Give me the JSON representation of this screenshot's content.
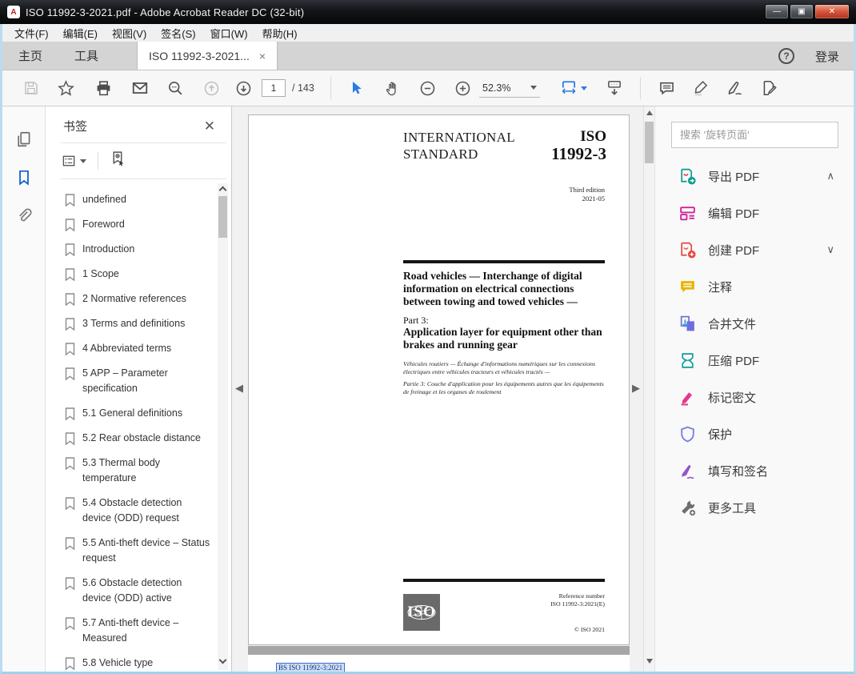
{
  "colors": {
    "accent_blue": "#2a7ce0",
    "bookmark_blue": "#1b66c9",
    "close_red": "#c0392b",
    "export_teal": "#0a9c8f",
    "edit_magenta": "#d6219c",
    "create_red": "#e5483f",
    "comment_yellow": "#e7b500",
    "combine_indigo": "#6e6ee0",
    "compress_teal": "#0a9c9c",
    "redact_pink": "#e5398d",
    "protect_periwinkle": "#7b7fe0",
    "sign_purple": "#9256c8",
    "more_gray": "#6e6e6e",
    "selection_blue": "#3b6bd6"
  },
  "window": {
    "title": "ISO 11992-3-2021.pdf - Adobe Acrobat Reader DC (32-bit)",
    "minimize_glyph": "—",
    "maximize_glyph": "▣",
    "close_glyph": "✕"
  },
  "menu": {
    "items": [
      "文件(F)",
      "编辑(E)",
      "视图(V)",
      "签名(S)",
      "窗口(W)",
      "帮助(H)"
    ]
  },
  "tabs": {
    "home": "主页",
    "tools": "工具",
    "document": "ISO 11992-3-2021...",
    "doc_close_glyph": "×",
    "help_glyph": "?",
    "sign_in": "登录"
  },
  "toolbar": {
    "page_current": "1",
    "page_total": "/ 143",
    "zoom_value": "52.3%"
  },
  "bookmarks": {
    "title": "书签",
    "items": [
      "undefined",
      "Foreword",
      "Introduction",
      "1 Scope",
      "2 Normative references",
      "3 Terms and definitions",
      "4 Abbreviated terms",
      "5 APP – Parameter specification",
      "5.1 General definitions",
      "5.2 Rear obstacle distance",
      "5.3 Thermal body temperature",
      "5.4 Obstacle detection device (ODD) request",
      "5.5 Anti-theft device – Status request",
      "5.6 Obstacle detection device (ODD) active",
      "5.7 Anti-theft device – Measured",
      "5.8 Vehicle type"
    ]
  },
  "document": {
    "header_left_1": "INTERNATIONAL",
    "header_left_2": "STANDARD",
    "std_number_1": "ISO",
    "std_number_2": "11992-3",
    "edition_1": "Third edition",
    "edition_2": "2021-05",
    "title_en": "Road vehicles — Interchange of digital information on electrical connections between towing and towed vehicles —",
    "part_label": "Part 3:",
    "subtitle_en": "Application layer for equipment other than brakes and running gear",
    "title_fr": "Véhicules routiers — Échange d'informations numériques sur les connexions électriques entre véhicules tracteurs et véhicules tractés —",
    "subtitle_fr": "Partie 3: Couche d'application pour les équipements autres que les équipements de freinage et les organes de roulement",
    "logo_text": "ISO",
    "reference_label": "Reference number",
    "reference_number": "ISO 11992-3:2021(E)",
    "copyright": "© ISO 2021",
    "page2_selected_text": "BS ISO 11992-3:2021"
  },
  "tools_panel": {
    "search_placeholder": "搜索 '旋转页面'",
    "items": [
      {
        "label": "导出 PDF",
        "chevron": "∧"
      },
      {
        "label": "编辑 PDF",
        "chevron": ""
      },
      {
        "label": "创建 PDF",
        "chevron": "∨"
      },
      {
        "label": "注释",
        "chevron": ""
      },
      {
        "label": "合并文件",
        "chevron": ""
      },
      {
        "label": "压缩 PDF",
        "chevron": ""
      },
      {
        "label": "标记密文",
        "chevron": ""
      },
      {
        "label": "保护",
        "chevron": ""
      },
      {
        "label": "填写和签名",
        "chevron": ""
      },
      {
        "label": "更多工具",
        "chevron": ""
      }
    ]
  }
}
